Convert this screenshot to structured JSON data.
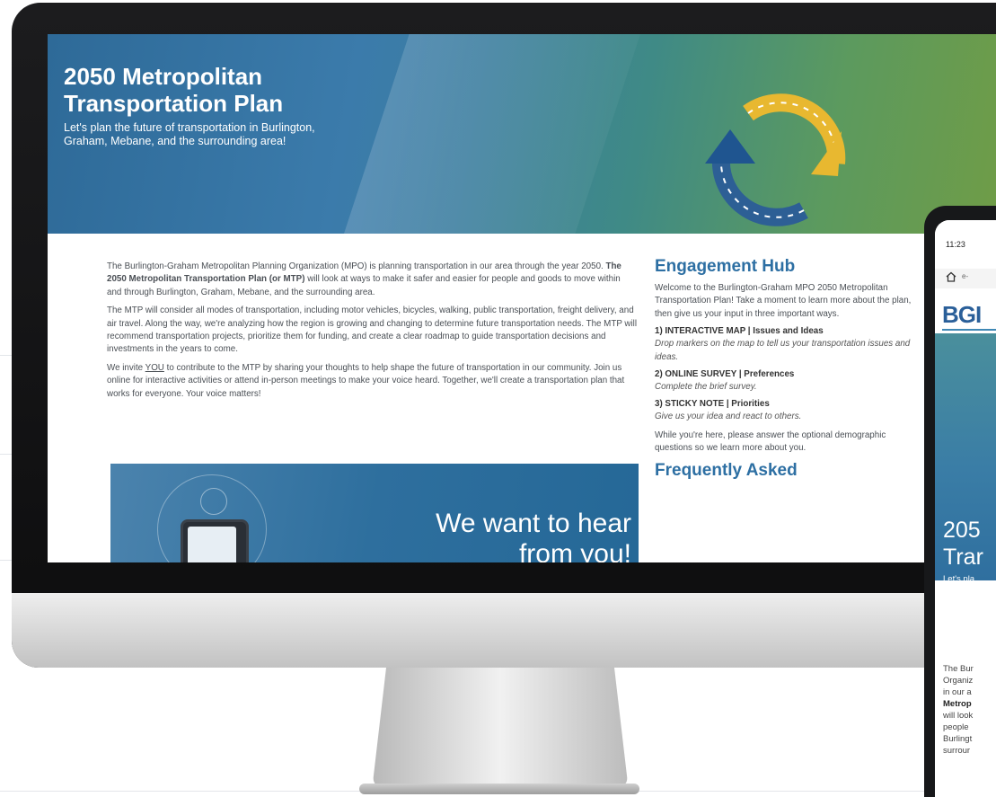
{
  "hero": {
    "title": "2050 Metropolitan Transportation Plan",
    "subtitle": "Let's plan the future of transportation in Burlington, Graham, Mebane, and the surrounding area!"
  },
  "main": {
    "p1_a": "The Burlington-Graham Metropolitan Planning Organization (MPO) is planning transportation in our area through the year 2050. ",
    "p1_b": "The 2050 Metropolitan Transportation Plan (or MTP)",
    "p1_c": " will look at ways to make it safer and easier for people and goods to move within and through Burlington, Graham, Mebane, and the surrounding area.",
    "p2": "The MTP will consider all modes of transportation, including motor vehicles, bicycles, walking, public transportation, freight delivery, and air travel. Along the way, we're analyzing how the region is growing and changing to determine future transportation needs. The MTP will recommend transportation projects, prioritize them for funding, and create a clear roadmap to guide transportation decisions and investments in the years to come.",
    "p3_a": "We invite ",
    "p3_you": "YOU",
    "p3_b": " to contribute to the MTP by sharing your thoughts to help shape the future of transportation in our community. Join us online for interactive activities or attend in-person meetings to make your voice heard. Together, we'll create a transportation plan that works for everyone. Your voice matters!",
    "banner": "We want to hear from you!"
  },
  "sidebar": {
    "heading": "Engagement Hub",
    "intro": "Welcome to the Burlington-Graham MPO 2050 Metropolitan Transportation Plan! Take a moment to learn more about the plan, then give us your input in three important ways.",
    "items": [
      {
        "title": "1) INTERACTIVE MAP | Issues and Ideas",
        "desc": "Drop markers on the map to tell us your transportation issues and ideas."
      },
      {
        "title": "2) ONLINE SURVEY | Preferences",
        "desc": "Complete the brief survey."
      },
      {
        "title": "3) STICKY NOTE | Priorities",
        "desc": "Give us your idea and react to others."
      }
    ],
    "outro": "While you're here, please answer the optional demographic questions so we learn more about you.",
    "faq_heading": "Frequently Asked"
  },
  "phone": {
    "time": "11:23",
    "url": "e-",
    "logo": "BGI",
    "title_line1": "205",
    "title_line2": "Trar",
    "sub_line1": "Let's pla",
    "sub_line2": "Burling",
    "sub_line3": "surrour",
    "body_lines": [
      "The Bur",
      "Organiz",
      "in our a",
      "Metrop",
      "will look",
      "people",
      "Burlingt",
      "surrour"
    ]
  },
  "colors": {
    "accent": "#2d6fa3",
    "hero_start": "#2e6a98",
    "hero_end": "#6f9c47",
    "logo_yellow": "#e8b830"
  }
}
